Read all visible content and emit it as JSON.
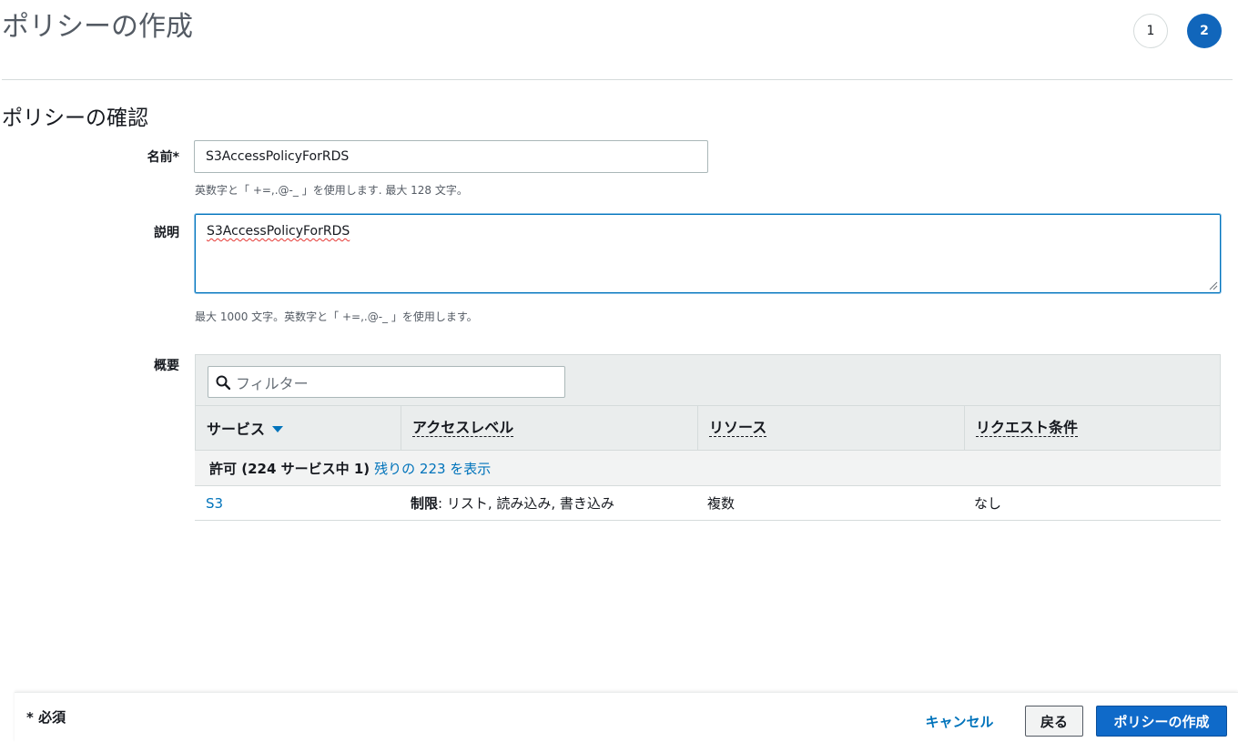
{
  "header": {
    "title": "ポリシーの作成",
    "steps": [
      "1",
      "2"
    ],
    "active_step": "2"
  },
  "section": {
    "title": "ポリシーの確認"
  },
  "form": {
    "name_label": "名前*",
    "name_value": "S3AccessPolicyForRDS",
    "name_hint": "英数字と「 +=,.@-_ 」を使用します. 最大 128 文字。",
    "description_label": "説明",
    "description_value": "S3AccessPolicyForRDS",
    "description_hint": "最大 1000 文字。英数字と「 +=,.@-_ 」を使用します。",
    "summary_label": "概要"
  },
  "summary_table": {
    "filter_placeholder": "フィルター",
    "columns": [
      "サービス",
      "アクセスレベル",
      "リソース",
      "リクエスト条件"
    ],
    "group": {
      "prefix": "許可 (224 サービス中 1)",
      "link": "残りの 223 を表示"
    },
    "rows": [
      {
        "service": "S3",
        "access_level_strong": "制限",
        "access_level_rest": ": リスト, 読み込み, 書き込み",
        "resource": "複数",
        "condition": "なし"
      }
    ]
  },
  "footer": {
    "required_note": "* 必須",
    "cancel_label": "キャンセル",
    "back_label": "戻る",
    "create_label": "ポリシーの作成"
  },
  "colors": {
    "primary": "#0f6ac9",
    "link": "#0073bb",
    "border": "#d5dbdb"
  }
}
